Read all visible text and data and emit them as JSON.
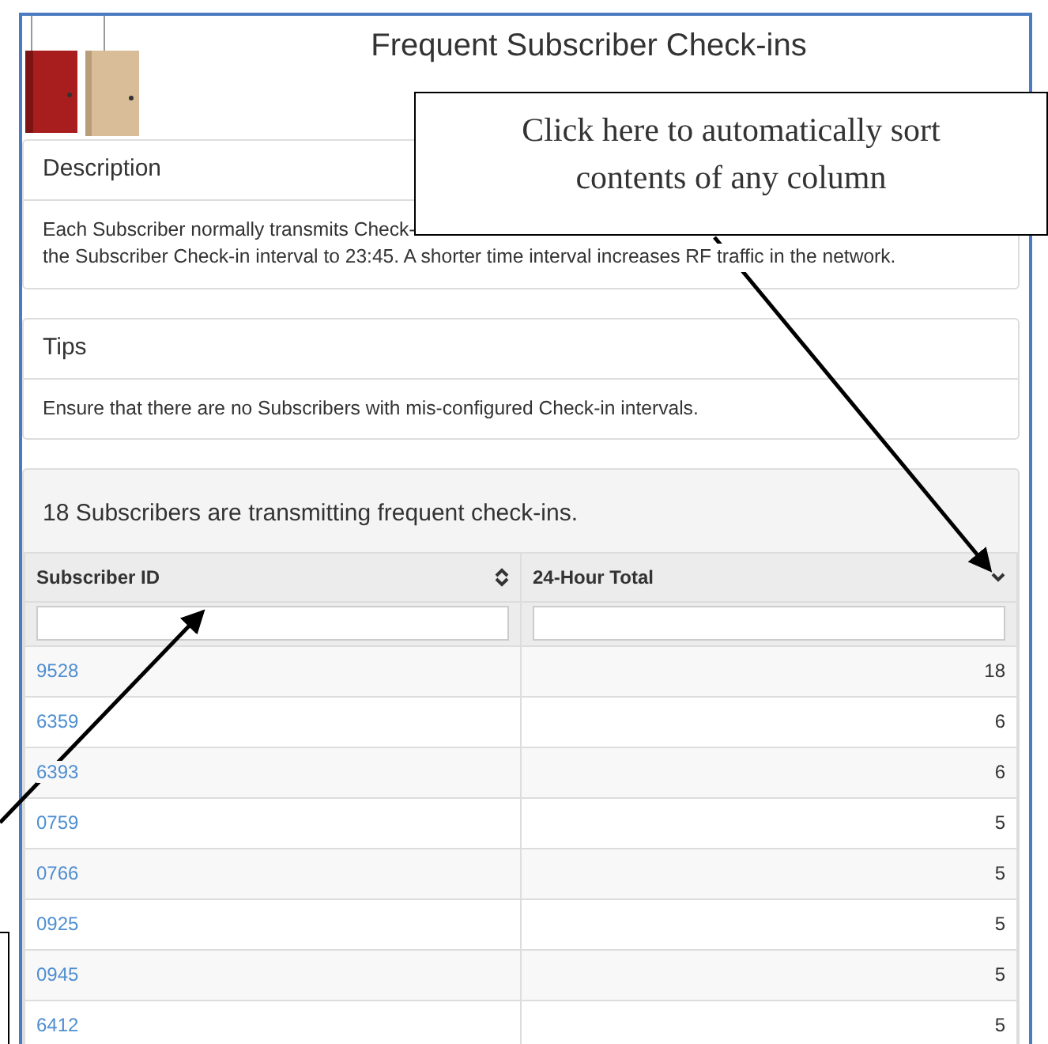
{
  "title": "Frequent Subscriber Check-ins",
  "description": {
    "heading": "Description",
    "lines": [
      "Each Subscriber normally transmits Check-",
      "the Subscriber Check-in interval to 23:45. A shorter time interval increases RF traffic in the network."
    ]
  },
  "tips": {
    "heading": "Tips",
    "text": "Ensure that there are no Subscribers with mis-configured Check-in intervals."
  },
  "results": {
    "heading": "18 Subscribers are transmitting frequent check-ins.",
    "columns": [
      {
        "label": "Subscriber ID",
        "sorted": false
      },
      {
        "label": "24-Hour Total",
        "sorted": true
      }
    ],
    "rows": [
      {
        "id": "9528",
        "total": "18"
      },
      {
        "id": "6359",
        "total": "6"
      },
      {
        "id": "6393",
        "total": "6"
      },
      {
        "id": "0759",
        "total": "5"
      },
      {
        "id": "0766",
        "total": "5"
      },
      {
        "id": "0925",
        "total": "5"
      },
      {
        "id": "0945",
        "total": "5"
      },
      {
        "id": "6412",
        "total": "5"
      }
    ]
  },
  "callouts": [
    {
      "text": "Click here to automatically sort contents of any column"
    }
  ]
}
